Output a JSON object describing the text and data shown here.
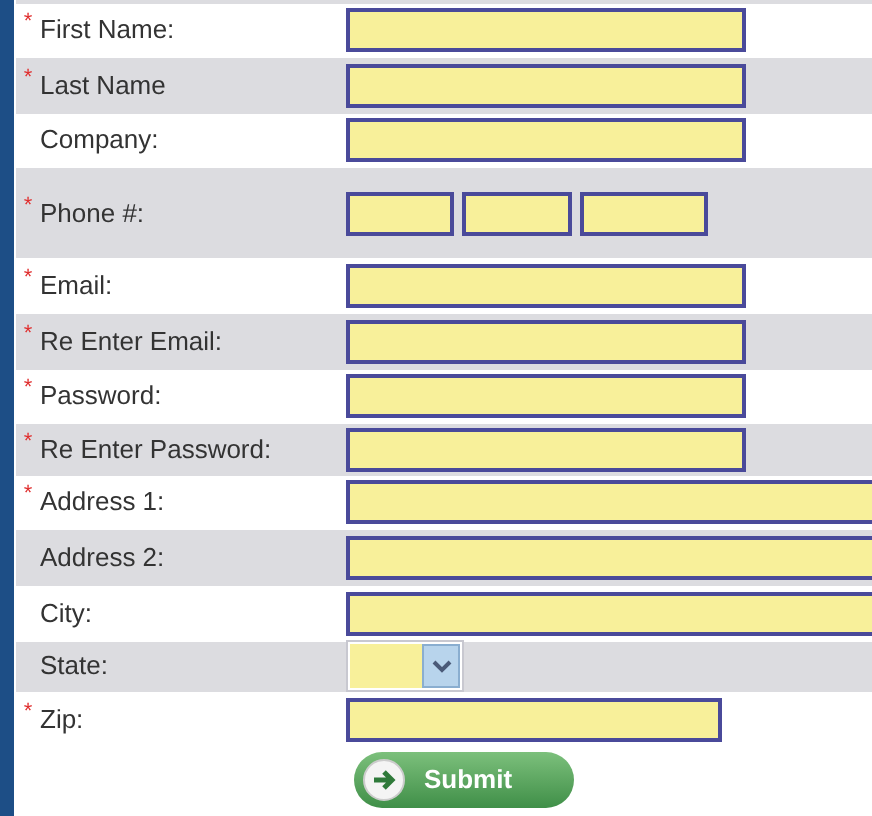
{
  "fields": [
    {
      "label": "First Name:",
      "required": true,
      "kind": "text"
    },
    {
      "label": "Last Name",
      "required": true,
      "kind": "text"
    },
    {
      "label": "Company:",
      "required": false,
      "kind": "text"
    },
    {
      "label": "Phone #:",
      "required": true,
      "kind": "phone"
    },
    {
      "label": "Email:",
      "required": true,
      "kind": "text"
    },
    {
      "label": "Re Enter Email:",
      "required": true,
      "kind": "text"
    },
    {
      "label": "Password:",
      "required": true,
      "kind": "text"
    },
    {
      "label": "Re Enter Password:",
      "required": true,
      "kind": "text"
    },
    {
      "label": "Address 1:",
      "required": true,
      "kind": "long"
    },
    {
      "label": "Address 2:",
      "required": false,
      "kind": "long"
    },
    {
      "label": "City:",
      "required": false,
      "kind": "long"
    },
    {
      "label": "State:",
      "required": false,
      "kind": "select"
    },
    {
      "label": "Zip:",
      "required": true,
      "kind": "short"
    }
  ],
  "required_mark": "*",
  "submit": "Submit"
}
